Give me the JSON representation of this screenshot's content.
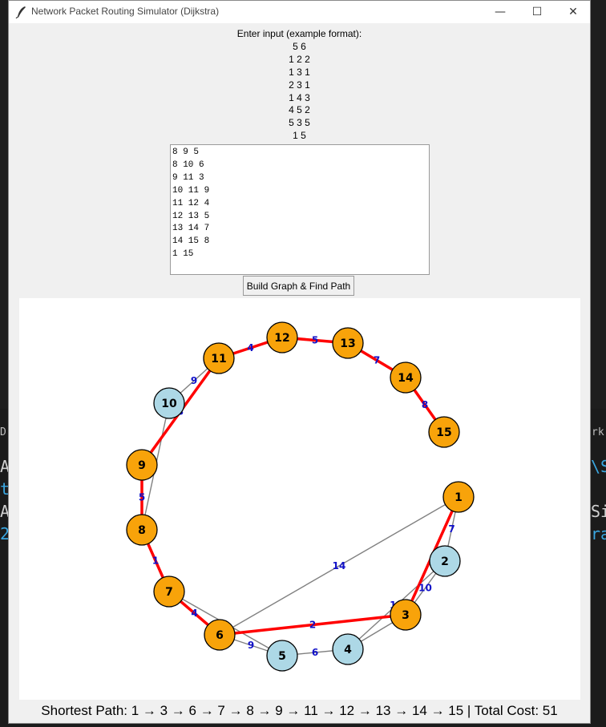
{
  "window": {
    "title": "Network Packet Routing Simulator (Dijkstra)",
    "minimize_symbol": "—",
    "maximize_symbol": "☐",
    "close_symbol": "✕"
  },
  "prompt": {
    "heading": "Enter input (example format):",
    "example_lines": [
      "5 6",
      "1 2 2",
      "1 3 1",
      "2 3 1",
      "1 4 3",
      "4 5 2",
      "5 3 5",
      "1 5"
    ]
  },
  "input_text_lines": [
    "8 9 5",
    "8 10 6",
    "9 11 3",
    "10 11 9",
    "11 12 4",
    "12 13 5",
    "13 14 7",
    "14 15 8",
    "1 15"
  ],
  "build_button_label": "Build Graph & Find Path",
  "graph": {
    "nodes": [
      {
        "id": "1",
        "on_path": true
      },
      {
        "id": "2",
        "on_path": false
      },
      {
        "id": "3",
        "on_path": true
      },
      {
        "id": "4",
        "on_path": false
      },
      {
        "id": "5",
        "on_path": false
      },
      {
        "id": "6",
        "on_path": true
      },
      {
        "id": "7",
        "on_path": true
      },
      {
        "id": "8",
        "on_path": true
      },
      {
        "id": "9",
        "on_path": true
      },
      {
        "id": "10",
        "on_path": false
      },
      {
        "id": "11",
        "on_path": true
      },
      {
        "id": "12",
        "on_path": true
      },
      {
        "id": "13",
        "on_path": true
      },
      {
        "id": "14",
        "on_path": true
      },
      {
        "id": "15",
        "on_path": true
      }
    ],
    "edges": [
      {
        "from": "1",
        "to": "2",
        "weight": "7"
      },
      {
        "from": "1",
        "to": "3",
        "weight": ""
      },
      {
        "from": "1",
        "to": "6",
        "weight": "14"
      },
      {
        "from": "2",
        "to": "3",
        "weight": "10"
      },
      {
        "from": "2",
        "to": "4",
        "weight": "11"
      },
      {
        "from": "3",
        "to": "4",
        "weight": ""
      },
      {
        "from": "3",
        "to": "6",
        "weight": "2"
      },
      {
        "from": "4",
        "to": "5",
        "weight": "6"
      },
      {
        "from": "5",
        "to": "6",
        "weight": "9"
      },
      {
        "from": "5",
        "to": "7",
        "weight": ""
      },
      {
        "from": "6",
        "to": "7",
        "weight": "4"
      },
      {
        "from": "7",
        "to": "8",
        "weight": "1"
      },
      {
        "from": "8",
        "to": "9",
        "weight": "5"
      },
      {
        "from": "8",
        "to": "10",
        "weight": ""
      },
      {
        "from": "9",
        "to": "11",
        "weight": "3"
      },
      {
        "from": "10",
        "to": "11",
        "weight": "9"
      },
      {
        "from": "11",
        "to": "12",
        "weight": "4"
      },
      {
        "from": "12",
        "to": "13",
        "weight": "5"
      },
      {
        "from": "13",
        "to": "14",
        "weight": "7"
      },
      {
        "from": "14",
        "to": "15",
        "weight": "8"
      }
    ],
    "path": [
      "1",
      "3",
      "6",
      "7",
      "8",
      "9",
      "11",
      "12",
      "13",
      "14",
      "15"
    ],
    "colors": {
      "path_node": "#f8a30a",
      "other_node": "#add8e6",
      "path_edge": "#ff0000",
      "edge": "#808080",
      "weight_text": "#1010c8"
    }
  },
  "result_text": "Shortest Path: 1 → 3 → 6 → 7 → 8 → 9 → 11 → 12 → 13 → 14 → 15 | Total Cost: 51",
  "background_terminal": {
    "fragments": [
      "D",
      "A",
      "t",
      "A",
      "2",
      "rk",
      "\\S",
      "Si",
      "ra"
    ]
  }
}
